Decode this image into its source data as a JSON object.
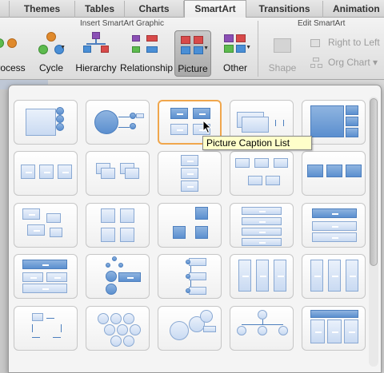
{
  "tabs": [
    {
      "label": "",
      "active": false
    },
    {
      "label": "Themes",
      "active": false
    },
    {
      "label": "Tables",
      "active": false
    },
    {
      "label": "Charts",
      "active": false
    },
    {
      "label": "SmartArt",
      "active": true
    },
    {
      "label": "Transitions",
      "active": false
    },
    {
      "label": "Animation",
      "active": false
    }
  ],
  "ribbon": {
    "insert_group_title": "Insert SmartArt Graphic",
    "edit_group_title": "Edit SmartArt",
    "buttons": {
      "process": "rocess",
      "cycle": "Cycle",
      "hierarchy": "Hierarchy",
      "relationship": "Relationship",
      "picture": "Picture",
      "other": "Other",
      "shape": "Shape",
      "right_to_left": "Right to Left",
      "org_chart": "Org Chart"
    }
  },
  "gallery": {
    "selected_index": 2,
    "layouts": [
      "r0c0",
      "r0c1",
      "r0c2",
      "r0c3",
      "r0c4",
      "r1c0",
      "r1c1",
      "r1c2",
      "r1c3",
      "r1c4",
      "r2c0",
      "r2c1",
      "r2c2",
      "r2c3",
      "r2c4",
      "r3c0",
      "r3c1",
      "r3c2",
      "r3c3",
      "r3c4",
      "r4c0",
      "r4c1",
      "r4c2",
      "r4c3",
      "r4c4"
    ]
  },
  "tooltip": "Picture Caption List",
  "colors": {
    "accent": "#5b8fcf",
    "selection": "#f0a64c",
    "tooltip_bg": "#ffffca"
  }
}
